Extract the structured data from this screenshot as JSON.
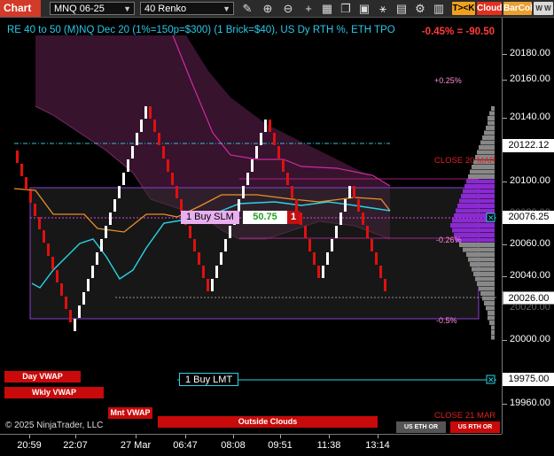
{
  "toolbar": {
    "title": "Chart",
    "instrument": "MNQ 06-25",
    "bar_type": "40 Renko",
    "buttons": {
      "tk": "T><K",
      "cloud": "Cloud",
      "barcol": "BarCol",
      "w": "W W W"
    },
    "icons": [
      "pencil-icon",
      "zoom-in-icon",
      "zoom-out-icon",
      "add-icon",
      "properties-icon",
      "copy-icon",
      "screenshot-icon",
      "indicator-icon",
      "settings-icon"
    ]
  },
  "chart": {
    "title": "RE 40 to 50 (M)NQ Dec 20 (1%=150p=$300) (1 Brick=$40), US Dy RTH %, ETH TPO",
    "pct_change": "-0.45% = -90.50",
    "annotations": {
      "plus_025": "+0.25%",
      "minus_026": "-0.26%",
      "minus_05": "-0.5%",
      "close_20_mar": "CLOSE 20 MAR",
      "close_21_mar": "CLOSE 21 MAR",
      "copyright": "© 2025 NinjaTrader, LLC"
    },
    "orders": {
      "buy_slm_label": "1 Buy SLM",
      "buy_slm_value": "50.75",
      "buy_slm_qty": "1",
      "buy_lmt_label": "1 Buy LMT"
    },
    "tags": {
      "day_vwap": "Day VWAP",
      "wkly_vwap": "Wkly VWAP",
      "mnt_vwap": "Mnt VWAP",
      "outside_clouds": "Outside Clouds",
      "us_eth_or": "US ETH OR",
      "us_rth_or": "US RTH OR"
    },
    "colors": {
      "bull": "#ffffff",
      "bear": "#e01010",
      "cloud": "#4a1a3c",
      "vwap_cyan": "#28d4e6",
      "orange": "#e8902a",
      "purple_box": "#8a40d0",
      "magenta": "#d02aa0"
    }
  },
  "price_axis": {
    "labels": [
      "20180.00",
      "20160.00",
      "20140.00",
      "20100.00",
      "20080.00",
      "20060.00",
      "20040.00",
      "20020.00",
      "20000.00",
      "19960.00"
    ],
    "flags": {
      "level1": "20122.12",
      "level2": "20076.25",
      "level3": "20026.00",
      "level4": "19975.00"
    }
  },
  "time_axis": {
    "labels": [
      "20:59",
      "22:07",
      "27 Mar",
      "06:47",
      "08:08",
      "09:51",
      "11:38",
      "13:14"
    ]
  }
}
